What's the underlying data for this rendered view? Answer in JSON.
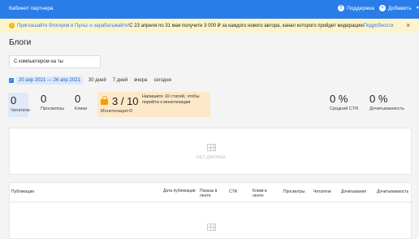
{
  "topbar": {
    "title": "Кабинет партнера",
    "support_label": "Поддержка",
    "support_icon": "question-icon",
    "add_label": "Добавить",
    "add_icon": "plus-icon",
    "accent": "#2a7de8"
  },
  "banner": {
    "link_text": "Приглашайте блогеров в Пульс и зарабатывайте!",
    "text": " С 23 апреля по 31 мая получите 3 000 ₽ за каждого нового автора, канал которого пройдет модерацию ",
    "details_link": "Подробности",
    "close_icon": "close-icon"
  },
  "page": {
    "title": "Блоги",
    "search_value": "С компьютером на ты"
  },
  "period": {
    "range": "20 апр 2021 — 26 апр 2021",
    "options": [
      "30 дней",
      "7 дней",
      "вчера",
      "сегодня"
    ]
  },
  "stats": {
    "readers": {
      "value": "0",
      "label": "Читатели"
    },
    "views": {
      "value": "0",
      "label": "Просмотры"
    },
    "clicks": {
      "value": "0",
      "label": "Клики"
    },
    "monetization": {
      "value": "3 / 10",
      "hint": "Напишите 10 статей, чтобы перейти к монетизации",
      "label": "Монетизация"
    },
    "ctr": {
      "value": "0 %",
      "label": "Средний CTR"
    },
    "readthrough": {
      "value": "0 %",
      "label": "Дочитываемость"
    }
  },
  "chart_panel": {
    "empty_text": "НЕТ ДАННЫХ"
  },
  "table": {
    "headers": [
      "Публикации",
      "Дата публикации",
      "Показы в ленте",
      "CTR",
      "Клики в ленте",
      "Просмотры",
      "Читатели",
      "Дочитывания",
      "Дочитываемость"
    ]
  }
}
